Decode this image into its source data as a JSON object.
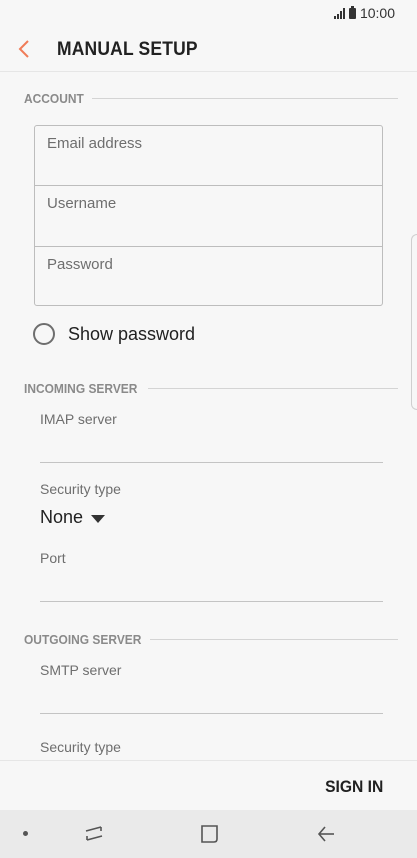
{
  "status_bar": {
    "time": "10:00",
    "signal_icon": "signal-icon",
    "battery_icon": "battery-icon"
  },
  "app_bar": {
    "title": "MANUAL SETUP",
    "back_icon": "chevron-left-icon",
    "accent_color": "#f07c58"
  },
  "account": {
    "header": "ACCOUNT",
    "email_placeholder": "Email address",
    "username_placeholder": "Username",
    "password_placeholder": "Password",
    "show_password_label": "Show password"
  },
  "incoming": {
    "header": "INCOMING SERVER",
    "imap_label": "IMAP server",
    "security_label": "Security type",
    "security_value": "None",
    "port_label": "Port"
  },
  "outgoing": {
    "header": "OUTGOING SERVER",
    "smtp_label": "SMTP server",
    "security_label": "Security type"
  },
  "footer": {
    "sign_in_label": "SIGN IN"
  },
  "nav_bar": {
    "items": [
      "dot-icon",
      "recent-apps-icon",
      "home-icon",
      "back-arrow-icon"
    ]
  }
}
